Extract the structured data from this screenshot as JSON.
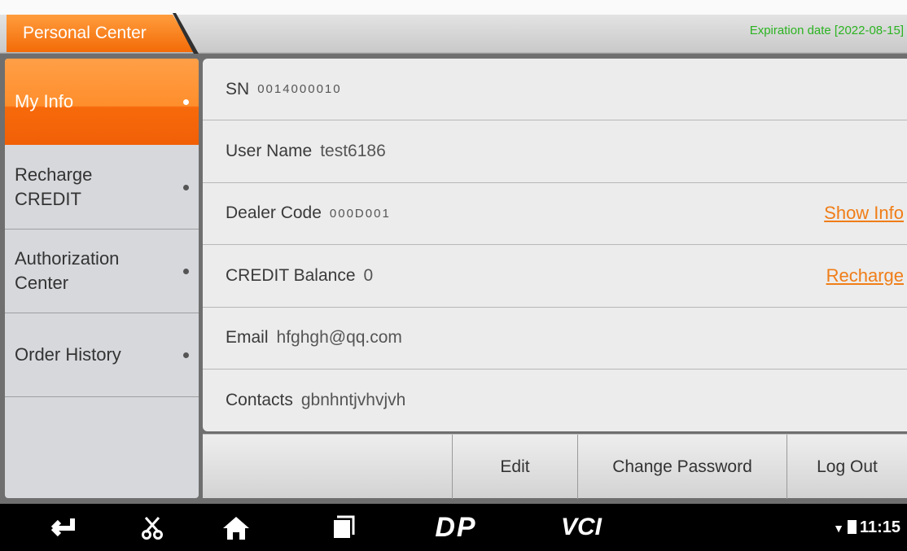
{
  "header": {
    "title": "Personal Center",
    "expiration": "Expiration date [2022-08-15]"
  },
  "sidebar": {
    "items": [
      {
        "label": "My Info",
        "active": true
      },
      {
        "label": "Recharge\nCREDIT",
        "active": false
      },
      {
        "label": "Authorization\nCenter",
        "active": false
      },
      {
        "label": "Order History",
        "active": false
      }
    ]
  },
  "info": {
    "sn_label": "SN",
    "sn_value": "0014000010",
    "username_label": "User Name",
    "username_value": "test6186",
    "dealer_label": "Dealer Code",
    "dealer_value": "000D001",
    "show_info": "Show Info",
    "credit_label": "CREDIT Balance",
    "credit_value": "0",
    "recharge": "Recharge",
    "email_label": "Email",
    "email_value": "hfghgh@qq.com",
    "contacts_label": "Contacts",
    "contacts_value": "gbnhntjvhvjvh"
  },
  "actions": {
    "edit": "Edit",
    "change_password": "Change Password",
    "logout": "Log Out"
  },
  "navbar": {
    "icons": [
      "back-icon",
      "scissors-icon",
      "home-icon",
      "recents-icon",
      "dp-logo-icon",
      "vci-icon"
    ],
    "dp_text": "DP",
    "vci_text": "VCI",
    "time": "11:15"
  },
  "colors": {
    "accent": "#f36b07",
    "expiry_green": "#2bb321",
    "link": "#f07d17"
  }
}
